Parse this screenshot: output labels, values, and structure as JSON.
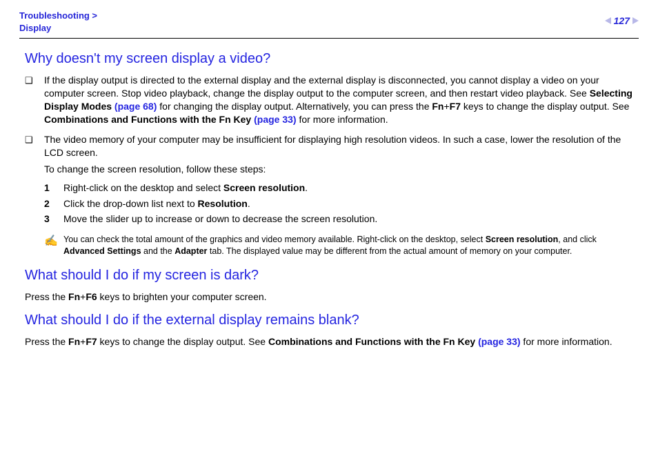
{
  "header": {
    "breadcrumb_top": "Troubleshooting >",
    "breadcrumb_bottom": "Display",
    "page_number": "127"
  },
  "sections": {
    "s1_title": "Why doesn't my screen display a video?",
    "s1_b1_pre": "If the display output is directed to the external display and the external display is disconnected, you cannot display a video on your computer screen. Stop video playback, change the display output to the computer screen, and then restart video playback. See ",
    "s1_b1_bold1": "Selecting Display Modes ",
    "s1_b1_link1": "(page 68)",
    "s1_b1_mid1": " for changing the display output. Alternatively, you can press the ",
    "s1_b1_fn": "Fn",
    "s1_b1_plus": "+",
    "s1_b1_f7": "F7",
    "s1_b1_mid2": " keys to change the display output. See ",
    "s1_b1_bold2": "Combinations and Functions with the Fn Key ",
    "s1_b1_link2": "(page 33)",
    "s1_b1_end": " for more information.",
    "s1_b2_p1": "The video memory of your computer may be insufficient for displaying high resolution videos. In such a case, lower the resolution of the LCD screen.",
    "s1_b2_p2": "To change the screen resolution, follow these steps:",
    "s1_step1_pre": "Right-click on the desktop and select ",
    "s1_step1_bold": "Screen resolution",
    "s1_step1_end": ".",
    "s1_step2_pre": "Click the drop-down list next to ",
    "s1_step2_bold": "Resolution",
    "s1_step2_end": ".",
    "s1_step3": "Move the slider up to increase or down to decrease the screen resolution.",
    "note_icon": "✍",
    "note_pre": "You can check the total amount of the graphics and video memory available. Right-click on the desktop, select ",
    "note_b1": "Screen resolution",
    "note_mid1": ", and click ",
    "note_b2": "Advanced Settings",
    "note_mid2": " and the ",
    "note_b3": "Adapter",
    "note_end": " tab. The displayed value may be different from the actual amount of memory on your computer.",
    "s2_title": "What should I do if my screen is dark?",
    "s2_pre": "Press the ",
    "s2_fn": "Fn",
    "s2_plus": "+",
    "s2_f6": "F6",
    "s2_end": " keys to brighten your computer screen.",
    "s3_title": "What should I do if the external display remains blank?",
    "s3_pre": "Press the ",
    "s3_fn": "Fn",
    "s3_plus": "+",
    "s3_f7": "F7",
    "s3_mid": " keys to change the display output. See ",
    "s3_bold": "Combinations and Functions with the Fn Key ",
    "s3_link": "(page 33)",
    "s3_end": " for more information."
  },
  "markers": {
    "bullet": "❑",
    "n1": "1",
    "n2": "2",
    "n3": "3"
  }
}
